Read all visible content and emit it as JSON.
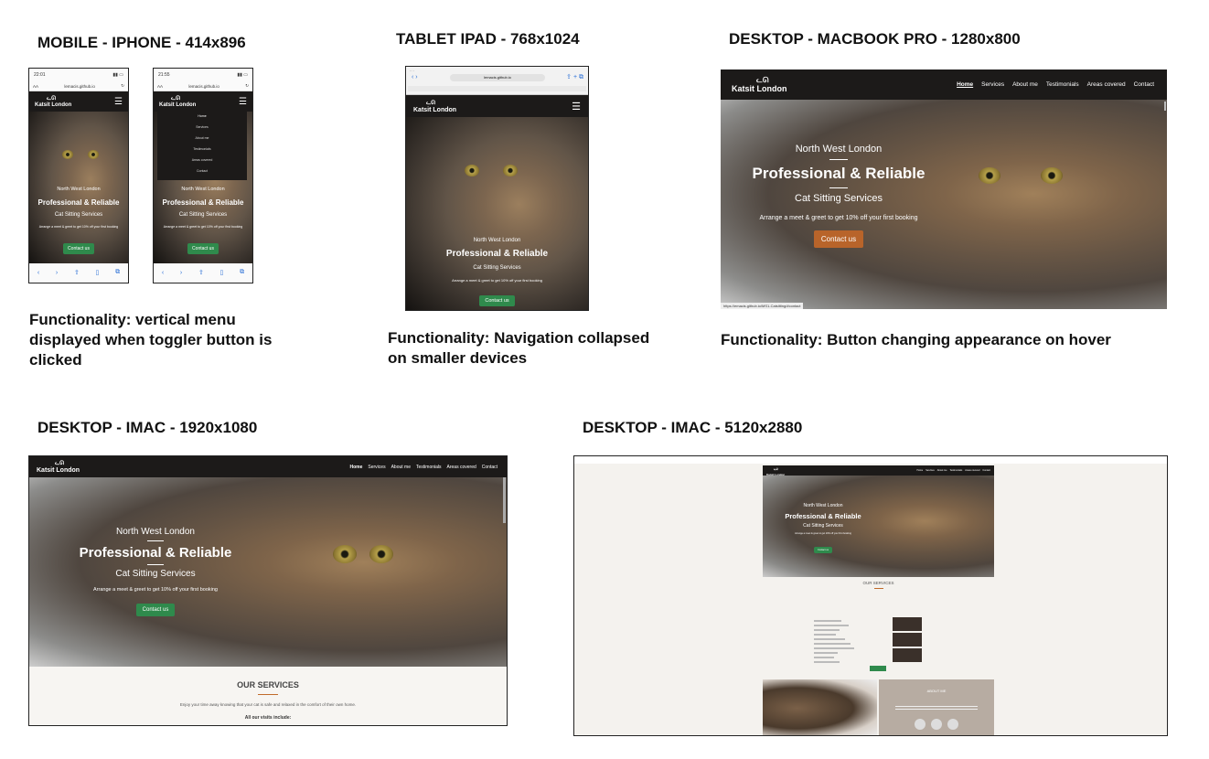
{
  "headings": {
    "mobile": "MOBILE - IPHONE - 414x896",
    "tablet": "TABLET IPAD - 768x1024",
    "macbook": "DESKTOP -  MACBOOK PRO - 1280x800",
    "imac1920": "DESKTOP - IMAC - 1920x1080",
    "imac5120": "DESKTOP - IMAC - 5120x2880"
  },
  "functionality": {
    "mobile": "Functionality: vertical menu displayed when toggler button is clicked",
    "tablet": "Functionality: Navigation collapsed on smaller devices",
    "macbook": "Functionality: Button changing appearance on hover"
  },
  "site": {
    "brand": "Katsit London",
    "nav": [
      "Home",
      "Services",
      "About me",
      "Testimonials",
      "Areas covered",
      "Contact"
    ],
    "hero_location": "North West London",
    "hero_title": "Professional & Reliable",
    "hero_sub": "Cat Sitting Services",
    "hero_offer": "Arrange a meet & greet to get 10% off your first booking",
    "cta": "Contact us",
    "services_title": "OUR SERVICES",
    "services_text": "Enjoy your time away knowing that your cat is safe and relaxed in the comfort of their own home.",
    "services_visits": "All our visits include:",
    "about_title": "ABOUT ME"
  },
  "phone": {
    "time1": "22:01",
    "time2": "21:55",
    "url": "lemacis.github.io",
    "aa": "AA"
  },
  "tablet": {
    "url": "lemacis.github.io"
  },
  "macbook": {
    "status_url": "https://emacis.github.io/MS1-Catsitting/#contact"
  },
  "colors": {
    "nav": "#1c1a19",
    "cta_green": "#2f8a4c",
    "cta_hover": "#b8642a",
    "accent": "#c06a2a"
  },
  "icons": {
    "menu": "hamburger-icon",
    "cat_logo": "cat-logo-icon"
  }
}
